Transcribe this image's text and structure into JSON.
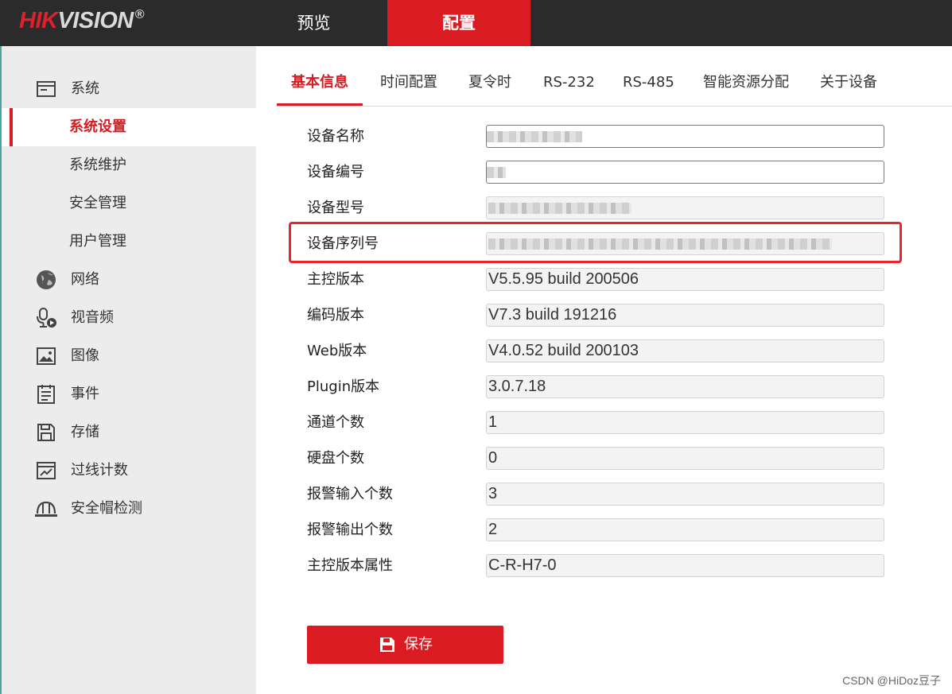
{
  "header": {
    "logo_brand_red": "HIK",
    "logo_brand_grey": "VISION",
    "logo_reg": "®",
    "nav": [
      {
        "label": "预览",
        "active": false
      },
      {
        "label": "配置",
        "active": true
      }
    ]
  },
  "sidebar": {
    "items": [
      {
        "label": "系统",
        "icon": "system-window-icon"
      },
      {
        "label": "系统设置",
        "sub": true,
        "active": true
      },
      {
        "label": "系统维护",
        "sub": true
      },
      {
        "label": "安全管理",
        "sub": true
      },
      {
        "label": "用户管理",
        "sub": true
      },
      {
        "label": "网络",
        "icon": "globe-icon"
      },
      {
        "label": "视音频",
        "icon": "microphone-icon"
      },
      {
        "label": "图像",
        "icon": "image-icon"
      },
      {
        "label": "事件",
        "icon": "event-list-icon"
      },
      {
        "label": "存储",
        "icon": "storage-icon"
      },
      {
        "label": "过线计数",
        "icon": "line-count-icon"
      },
      {
        "label": "安全帽检测",
        "icon": "helmet-icon"
      }
    ]
  },
  "tabs": [
    {
      "label": "基本信息",
      "active": true
    },
    {
      "label": "时间配置"
    },
    {
      "label": "夏令时"
    },
    {
      "label": "RS-232"
    },
    {
      "label": "RS-485"
    },
    {
      "label": "智能资源分配"
    },
    {
      "label": "关于设备"
    }
  ],
  "form": {
    "rows": [
      {
        "label": "设备名称",
        "value": "",
        "editable": true,
        "blurred": true
      },
      {
        "label": "设备编号",
        "value": "",
        "editable": true,
        "blurred": true
      },
      {
        "label": "设备型号",
        "value": "",
        "editable": false,
        "blurred": true
      },
      {
        "label": "设备序列号",
        "value": "",
        "editable": false,
        "blurred": true
      },
      {
        "label": "主控版本",
        "value": "V5.5.95 build 200506",
        "editable": false
      },
      {
        "label": "编码版本",
        "value": "V7.3 build 191216",
        "editable": false
      },
      {
        "label": "Web版本",
        "value": "V4.0.52 build 200103",
        "editable": false
      },
      {
        "label": "Plugin版本",
        "value": "3.0.7.18",
        "editable": false
      },
      {
        "label": "通道个数",
        "value": "1",
        "editable": false
      },
      {
        "label": "硬盘个数",
        "value": "0",
        "editable": false
      },
      {
        "label": "报警输入个数",
        "value": "3",
        "editable": false
      },
      {
        "label": "报警输出个数",
        "value": "2",
        "editable": false
      },
      {
        "label": "主控版本属性",
        "value": "C-R-H7-0",
        "editable": false
      }
    ]
  },
  "save_button": {
    "label": "保存",
    "icon": "floppy-save-icon"
  },
  "watermark": "CSDN @HiDoz豆子",
  "colors": {
    "accent": "#da1b22",
    "topbar": "#2b2b2b",
    "sidebar": "#ececec",
    "highlight": "#e8262b"
  }
}
